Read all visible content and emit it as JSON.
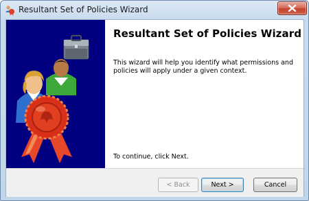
{
  "window": {
    "title": "Resultant Set of Policies Wizard",
    "icon": "rsop-icon",
    "close_icon": "close-icon"
  },
  "banner": {
    "background_color": "#000080",
    "image": "users-with-briefcase-and-seal-illustration"
  },
  "content": {
    "heading": "Resultant Set of Policies Wizard",
    "description": "This wizard will help you identify what permissions and policies will apply under a given context.",
    "instruction": "To continue, click Next."
  },
  "footer": {
    "back_label": "< Back",
    "next_label": "Next >",
    "cancel_label": "Cancel"
  }
}
